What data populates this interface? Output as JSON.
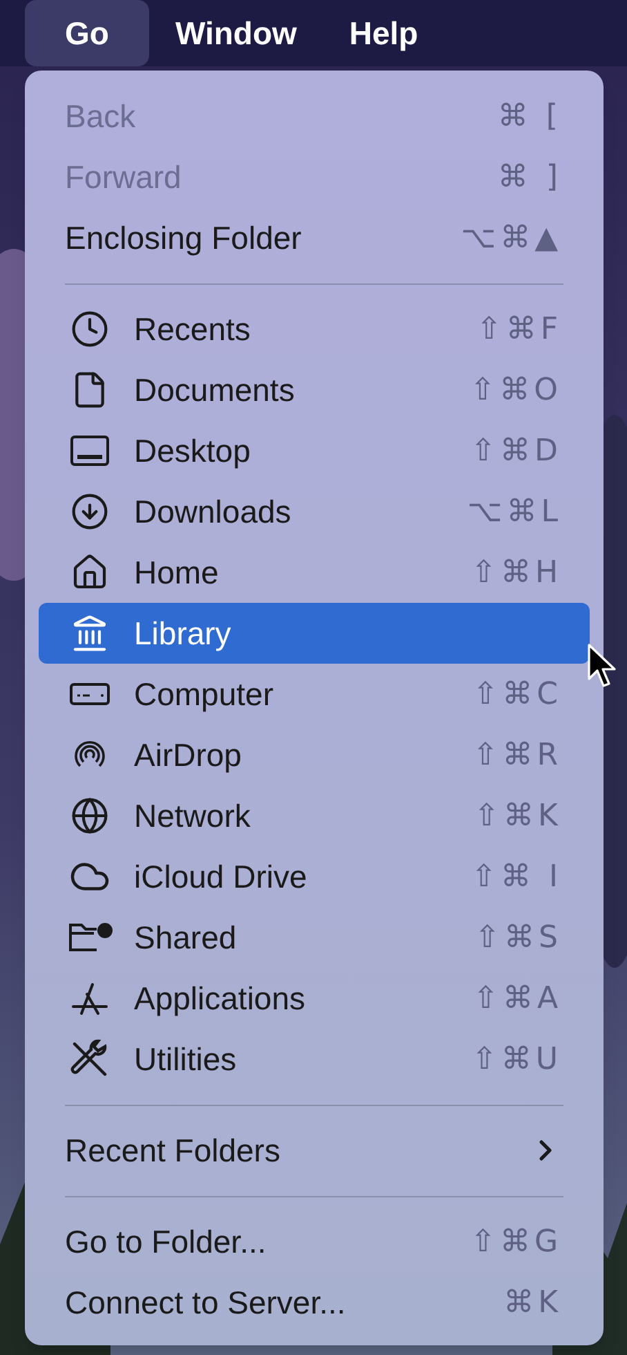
{
  "menu_bar": {
    "items": [
      {
        "label": "Go",
        "selected": true
      },
      {
        "label": "Window",
        "selected": false
      },
      {
        "label": "Help",
        "selected": false
      }
    ]
  },
  "menu": {
    "sections": [
      {
        "items": [
          {
            "kind": "item",
            "label": "Back",
            "shortcut": "⌘ [",
            "disabled": true,
            "selected": false
          },
          {
            "kind": "item",
            "label": "Forward",
            "shortcut": "⌘ ]",
            "disabled": true,
            "selected": false
          },
          {
            "kind": "item",
            "label": "Enclosing Folder",
            "shortcut": "⌥⌘▲",
            "disabled": false,
            "selected": false
          }
        ]
      },
      {
        "items": [
          {
            "kind": "item",
            "label": "Recents",
            "shortcut": "⇧⌘F",
            "disabled": false,
            "selected": false
          },
          {
            "kind": "item",
            "label": "Documents",
            "shortcut": "⇧⌘O",
            "disabled": false,
            "selected": false
          },
          {
            "kind": "item",
            "label": "Desktop",
            "shortcut": "⇧⌘D",
            "disabled": false,
            "selected": false
          },
          {
            "kind": "item",
            "label": "Downloads",
            "shortcut": "⌥⌘L",
            "disabled": false,
            "selected": false
          },
          {
            "kind": "item",
            "label": "Home",
            "shortcut": "⇧⌘H",
            "disabled": false,
            "selected": false
          },
          {
            "kind": "item",
            "label": "Library",
            "disabled": false,
            "selected": true
          },
          {
            "kind": "item",
            "label": "Computer",
            "shortcut": "⇧⌘C",
            "disabled": false,
            "selected": false
          },
          {
            "kind": "item",
            "label": "AirDrop",
            "shortcut": "⇧⌘R",
            "disabled": false,
            "selected": false
          },
          {
            "kind": "item",
            "label": "Network",
            "shortcut": "⇧⌘K",
            "disabled": false,
            "selected": false
          },
          {
            "kind": "item",
            "label": "iCloud Drive",
            "shortcut": "⇧⌘ I",
            "disabled": false,
            "selected": false
          },
          {
            "kind": "item",
            "label": "Shared",
            "shortcut": "⇧⌘S",
            "disabled": false,
            "selected": false
          },
          {
            "kind": "item",
            "label": "Applications",
            "shortcut": "⇧⌘A",
            "disabled": false,
            "selected": false
          },
          {
            "kind": "item",
            "label": "Utilities",
            "shortcut": "⇧⌘U",
            "disabled": false,
            "selected": false
          }
        ]
      },
      {
        "items": [
          {
            "kind": "submenu",
            "label": "Recent Folders",
            "disabled": false,
            "selected": false
          }
        ]
      },
      {
        "items": [
          {
            "kind": "item",
            "label": "Go to Folder...",
            "shortcut": "⇧⌘G",
            "disabled": false,
            "selected": false
          },
          {
            "kind": "item",
            "label": "Connect to Server...",
            "shortcut": "⌘K",
            "disabled": false,
            "selected": false
          }
        ]
      }
    ]
  }
}
